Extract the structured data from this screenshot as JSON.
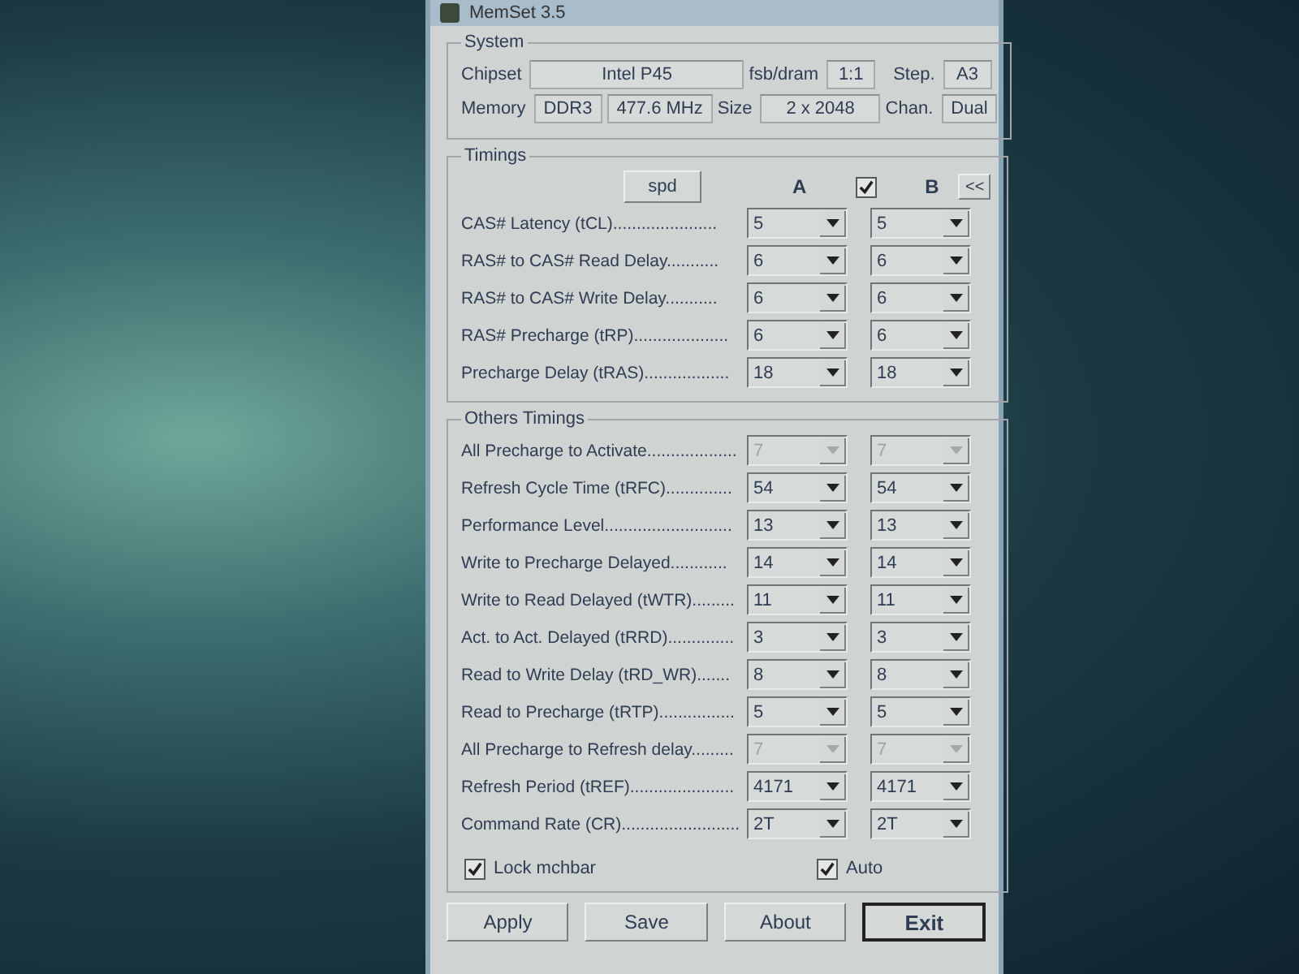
{
  "window": {
    "title": "MemSet 3.5"
  },
  "system": {
    "title": "System",
    "chipset_label": "Chipset",
    "chipset": "Intel P45",
    "fsb_dram_label": "fsb/dram",
    "fsb_dram": "1:1",
    "step_label": "Step.",
    "step": "A3",
    "memory_label": "Memory",
    "memory_type": "DDR3",
    "frequency": "477.6 MHz",
    "size_label": "Size",
    "size": "2 x 2048",
    "channel_label": "Chan.",
    "channel": "Dual"
  },
  "timings": {
    "title": "Timings",
    "spd_button": "spd",
    "column_a": "A",
    "link": {
      "checked": true
    },
    "column_b": "B",
    "collapse_button": "<<",
    "rows": [
      {
        "label": "CAS# Latency (tCL)......................",
        "a": "5",
        "b": "5",
        "disabled": false
      },
      {
        "label": "RAS# to CAS# Read Delay...........",
        "a": "6",
        "b": "6",
        "disabled": false
      },
      {
        "label": "RAS# to CAS# Write Delay...........",
        "a": "6",
        "b": "6",
        "disabled": false
      },
      {
        "label": "RAS# Precharge (tRP)....................",
        "a": "6",
        "b": "6",
        "disabled": false
      },
      {
        "label": "Precharge Delay  (tRAS)..................",
        "a": "18",
        "b": "18",
        "disabled": false
      }
    ]
  },
  "other_timings": {
    "title": "Others Timings",
    "rows": [
      {
        "label": "All Precharge to Activate...................",
        "a": "7",
        "b": "7",
        "disabled": true
      },
      {
        "label": "Refresh Cycle Time (tRFC)..............",
        "a": "54",
        "b": "54",
        "disabled": false
      },
      {
        "label": "Performance Level...........................",
        "a": "13",
        "b": "13",
        "disabled": false
      },
      {
        "label": "Write to Precharge Delayed............",
        "a": "14",
        "b": "14",
        "disabled": false
      },
      {
        "label": "Write to Read Delayed (tWTR).........",
        "a": "11",
        "b": "11",
        "disabled": false
      },
      {
        "label": "Act. to Act. Delayed (tRRD)..............",
        "a": "3",
        "b": "3",
        "disabled": false
      },
      {
        "label": "Read to Write Delay (tRD_WR).......",
        "a": "8",
        "b": "8",
        "disabled": false
      },
      {
        "label": "Read to Precharge (tRTP)................",
        "a": "5",
        "b": "5",
        "disabled": false
      },
      {
        "label": "All Precharge to Refresh delay.........",
        "a": "7",
        "b": "7",
        "disabled": true
      },
      {
        "label": "Refresh Period (tREF)......................",
        "a": "4171",
        "b": "4171",
        "disabled": false
      },
      {
        "label": "Command Rate (CR).........................",
        "a": "2T",
        "b": "2T",
        "disabled": false
      }
    ]
  },
  "lock_mchbar": {
    "label": "Lock mchbar",
    "checked": true
  },
  "auto": {
    "label": "Auto",
    "checked": true
  },
  "buttons": [
    {
      "label": "Apply",
      "default": false
    },
    {
      "label": "Save",
      "default": false
    },
    {
      "label": "About",
      "default": false
    },
    {
      "label": "Exit",
      "default": true
    }
  ]
}
